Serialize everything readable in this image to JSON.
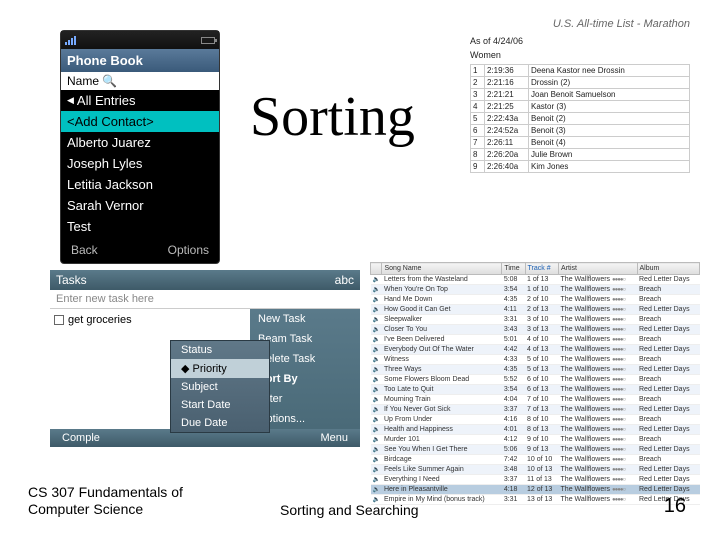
{
  "title": "Sorting",
  "footer": {
    "left1": "CS 307 Fundamentals of",
    "left2": "Computer Science",
    "center": "Sorting and Searching",
    "page": "16"
  },
  "phone": {
    "title": "Phone Book",
    "name_label": "Name",
    "entries": "All Entries",
    "add": "<Add Contact>",
    "items": [
      "Alberto Juarez",
      "Joseph Lyles",
      "Letitia Jackson",
      "Sarah Vernor",
      "Test"
    ],
    "soft_left": "Back",
    "soft_right": "Options"
  },
  "marathon": {
    "header": "U.S. All-time List - Marathon",
    "asof": "As of 4/24/06",
    "group": "Women",
    "rows": [
      [
        "1",
        "2:19:36",
        "Deena Kastor nee Drossin"
      ],
      [
        "2",
        "2:21:16",
        "Drossin (2)"
      ],
      [
        "3",
        "2:21:21",
        "Joan Benoit Samuelson"
      ],
      [
        "4",
        "2:21:25",
        "Kastor (3)"
      ],
      [
        "5",
        "2:22:43a",
        "Benoit (2)"
      ],
      [
        "6",
        "2:24:52a",
        "Benoit (3)"
      ],
      [
        "7",
        "2:26:11",
        "Benoit (4)"
      ],
      [
        "8",
        "2:26:20a",
        "Julie Brown"
      ],
      [
        "9",
        "2:26:40a",
        "Kim Jones"
      ]
    ]
  },
  "tasks": {
    "title": "Tasks",
    "badge": "abc",
    "new_placeholder": "Enter new task here",
    "item": "get groceries",
    "menu": [
      "New Task",
      "Beam Task",
      "Delete Task",
      "Sort By",
      "Filter",
      "Options..."
    ],
    "submenu": [
      "Status",
      "Priority",
      "Subject",
      "Start Date",
      "Due Date"
    ],
    "foot_left": "Comple",
    "foot_right": "Menu"
  },
  "itunes": {
    "cols": [
      "Song Name",
      "Time",
      "Track #",
      "Artist",
      "Album"
    ],
    "rows": [
      [
        "Letters from the Wasteland",
        "5:08",
        "1 of 13",
        "The Wallflowers",
        "Red Letter Days"
      ],
      [
        "When You're On Top",
        "3:54",
        "1 of 10",
        "The Wallflowers",
        "Breach"
      ],
      [
        "Hand Me Down",
        "4:35",
        "2 of 10",
        "The Wallflowers",
        "Breach"
      ],
      [
        "How Good it Can Get",
        "4:11",
        "2 of 13",
        "The Wallflowers",
        "Red Letter Days"
      ],
      [
        "Sleepwalker",
        "3:31",
        "3 of 10",
        "The Wallflowers",
        "Breach"
      ],
      [
        "Closer To You",
        "3:43",
        "3 of 13",
        "The Wallflowers",
        "Red Letter Days"
      ],
      [
        "I've Been Delivered",
        "5:01",
        "4 of 10",
        "The Wallflowers",
        "Breach"
      ],
      [
        "Everybody Out Of The Water",
        "4:42",
        "4 of 13",
        "The Wallflowers",
        "Red Letter Days"
      ],
      [
        "Witness",
        "4:33",
        "5 of 10",
        "The Wallflowers",
        "Breach"
      ],
      [
        "Three Ways",
        "4:35",
        "5 of 13",
        "The Wallflowers",
        "Red Letter Days"
      ],
      [
        "Some Flowers Bloom Dead",
        "5:52",
        "6 of 10",
        "The Wallflowers",
        "Breach"
      ],
      [
        "Too Late to Quit",
        "3:54",
        "6 of 13",
        "The Wallflowers",
        "Red Letter Days"
      ],
      [
        "Mourning Train",
        "4:04",
        "7 of 10",
        "The Wallflowers",
        "Breach"
      ],
      [
        "If You Never Got Sick",
        "3:37",
        "7 of 13",
        "The Wallflowers",
        "Red Letter Days"
      ],
      [
        "Up From Under",
        "4:16",
        "8 of 10",
        "The Wallflowers",
        "Breach"
      ],
      [
        "Health and Happiness",
        "4:01",
        "8 of 13",
        "The Wallflowers",
        "Red Letter Days"
      ],
      [
        "Murder 101",
        "4:12",
        "9 of 10",
        "The Wallflowers",
        "Breach"
      ],
      [
        "See You When I Get There",
        "5:06",
        "9 of 13",
        "The Wallflowers",
        "Red Letter Days"
      ],
      [
        "Birdcage",
        "7:42",
        "10 of 10",
        "The Wallflowers",
        "Breach"
      ],
      [
        "Feels Like Summer Again",
        "3:48",
        "10 of 13",
        "The Wallflowers",
        "Red Letter Days"
      ],
      [
        "Everything I Need",
        "3:37",
        "11 of 13",
        "The Wallflowers",
        "Red Letter Days"
      ],
      [
        "Here in Pleasantville",
        "4:18",
        "12 of 13",
        "The Wallflowers",
        "Red Letter Days"
      ],
      [
        "Empire in My Mind (bonus track)",
        "3:31",
        "13 of 13",
        "The Wallflowers",
        "Red Letter Days"
      ]
    ]
  }
}
